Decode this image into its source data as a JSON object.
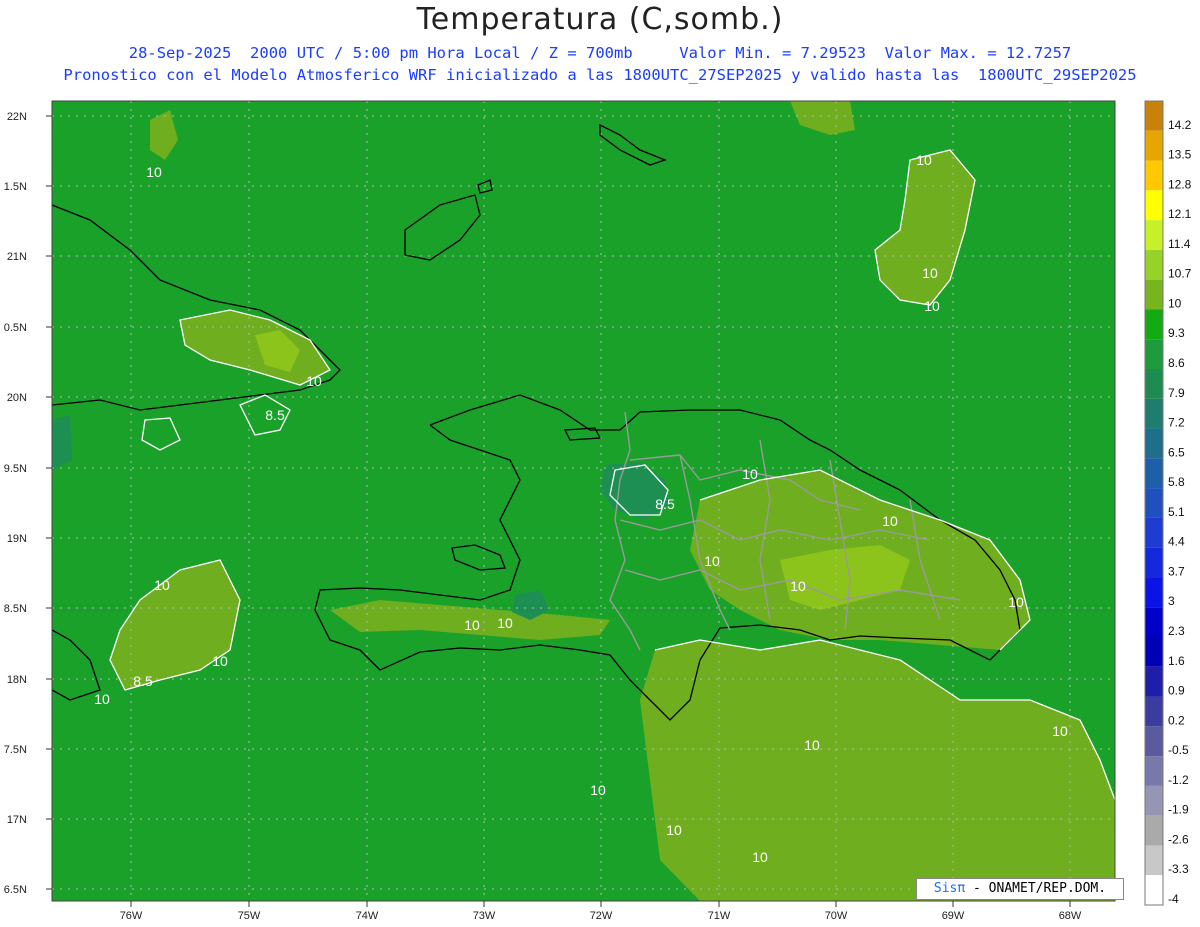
{
  "header": {
    "title": "Temperatura (C,somb.)",
    "subtitle_line1": "28-Sep-2025  2000 UTC / 5:00 pm Hora Local / Z = 700mb     Valor Min. = 7.29523  Valor Max. = 12.7257",
    "subtitle_line2": "Pronostico con el Modelo Atmosferico WRF inicializado a las 1800UTC_27SEP2025 y valido hasta las  1800UTC_29SEP2025"
  },
  "axes": {
    "lat_labels": [
      "22N",
      "1.5N",
      "21N",
      "0.5N",
      "20N",
      "9.5N",
      "19N",
      "8.5N",
      "18N",
      "7.5N",
      "17N",
      "6.5N"
    ],
    "lon_labels": [
      "76W",
      "75W",
      "74W",
      "73W",
      "72W",
      "71W",
      "70W",
      "69W",
      "68W"
    ]
  },
  "colorbar": {
    "labels": [
      "14.2",
      "13.5",
      "12.8",
      "12.1",
      "11.4",
      "10.7",
      "10",
      "9.3",
      "8.6",
      "7.9",
      "7.2",
      "6.5",
      "5.8",
      "5.1",
      "4.4",
      "3.7",
      "3",
      "2.3",
      "1.6",
      "0.9",
      "0.2",
      "-0.5",
      "-1.2",
      "-1.9",
      "-2.6",
      "-3.3",
      "-4"
    ],
    "colors": [
      "#c8820a",
      "#e6a500",
      "#ffc800",
      "#ffff00",
      "#c8f028",
      "#96d228",
      "#78b41e",
      "#14aa14",
      "#1e9b3c",
      "#1e8c50",
      "#1e7d6e",
      "#1e6e8c",
      "#1e5faa",
      "#1e50be",
      "#1e3cd2",
      "#1428dc",
      "#0a14e6",
      "#0000c8",
      "#0000b4",
      "#1e1eaa",
      "#3c3ca0",
      "#5a5aa0",
      "#7878aa",
      "#9696b4",
      "#aaaaaa",
      "#c8c8c8",
      "#ffffff"
    ]
  },
  "map": {
    "base_color": "#1aa12a",
    "warm_color": "#6fae1e",
    "warm_light": "#8cc41c",
    "cool_color": "#1e8f52",
    "contour_labels": [
      "10",
      "10",
      "10",
      "10",
      "10",
      "8.5",
      "8.5",
      "10",
      "10",
      "10",
      "10",
      "10",
      "10",
      "10",
      "10",
      "10",
      "8.5",
      "10",
      "10",
      "10",
      "10",
      "10",
      "10"
    ]
  },
  "footer": {
    "credit_brand": "Sisπ",
    "credit_text": " - ONAMET/REP.DOM."
  }
}
